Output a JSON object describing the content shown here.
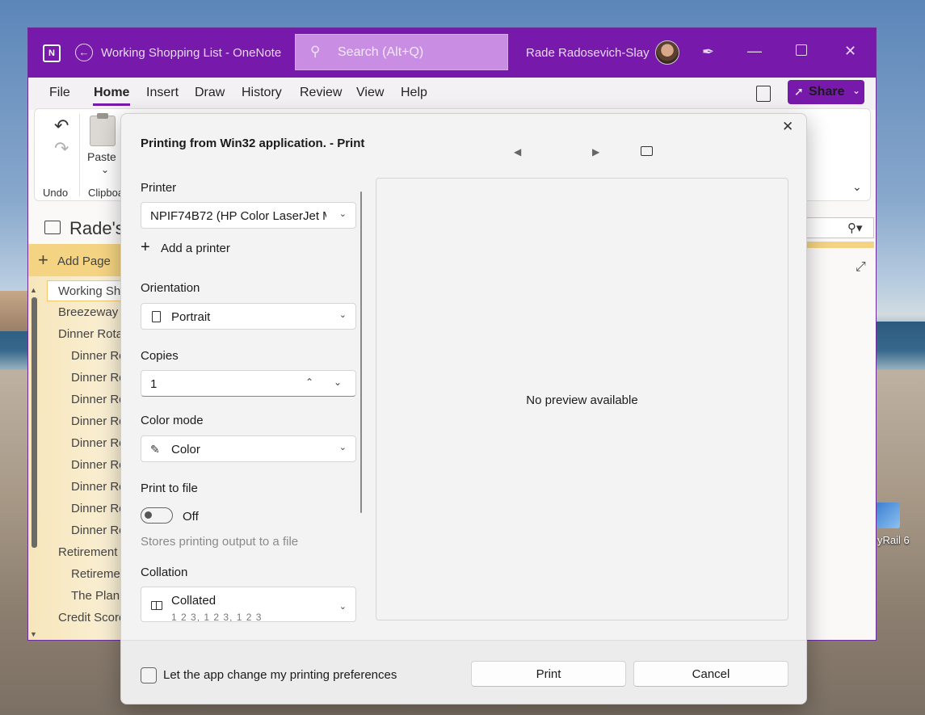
{
  "window": {
    "title": "Working Shopping List  -  OneNote",
    "search_placeholder": "Search (Alt+Q)",
    "user_name": "Rade Radosevich-Slay",
    "logo_text": "N"
  },
  "menubar": {
    "items": [
      "File",
      "Home",
      "Insert",
      "Draw",
      "History",
      "Review",
      "View",
      "Help"
    ],
    "active": "Home",
    "share_label": "Share"
  },
  "ribbon": {
    "undo_label": "Undo",
    "paste_label": "Paste",
    "clipboard_label": "Clipboa"
  },
  "notebook": {
    "title": "Rade's",
    "add_page_label": "Add Page"
  },
  "pages": [
    {
      "label": "Working Sho",
      "indent": 0,
      "selected": true
    },
    {
      "label": "Breezeway I",
      "indent": 0
    },
    {
      "label": "Dinner Rota",
      "indent": 0
    },
    {
      "label": "Dinner Ro",
      "indent": 1
    },
    {
      "label": "Dinner Ro",
      "indent": 1
    },
    {
      "label": "Dinner Ro",
      "indent": 1
    },
    {
      "label": "Dinner Ro",
      "indent": 1
    },
    {
      "label": "Dinner Ro",
      "indent": 1
    },
    {
      "label": "Dinner Ro",
      "indent": 1
    },
    {
      "label": "Dinner Ro",
      "indent": 1
    },
    {
      "label": "Dinner Ro",
      "indent": 1
    },
    {
      "label": "Dinner Ro",
      "indent": 1
    },
    {
      "label": "Retirement",
      "indent": 0
    },
    {
      "label": "Retiremen",
      "indent": 1
    },
    {
      "label": "The Plan:",
      "indent": 1
    },
    {
      "label": "Credit Score",
      "indent": 0
    }
  ],
  "print_dialog": {
    "title": "Printing from Win32 application. - Print",
    "printer_label": "Printer",
    "printer_value": "NPIF74B72 (HP Color LaserJet M",
    "add_printer_label": "Add a printer",
    "orientation_label": "Orientation",
    "orientation_value": "Portrait",
    "copies_label": "Copies",
    "copies_value": "1",
    "color_mode_label": "Color mode",
    "color_mode_value": "Color",
    "print_to_file_label": "Print to file",
    "print_to_file_state": "Off",
    "print_to_file_helper": "Stores printing output to a file",
    "collation_label": "Collation",
    "collation_value": "Collated",
    "collation_sub": "1 2 3, 1 2 3, 1 2 3",
    "preview_text": "No preview available",
    "preferences_checkbox_label": "Let the app change my printing preferences",
    "print_button": "Print",
    "cancel_button": "Cancel"
  },
  "desktop": {
    "icon_label": "yRail 6"
  },
  "colors": {
    "accent": "#7719aa",
    "page_list_bg": "#f7e6bb",
    "add_page_bg": "#f4d382"
  }
}
